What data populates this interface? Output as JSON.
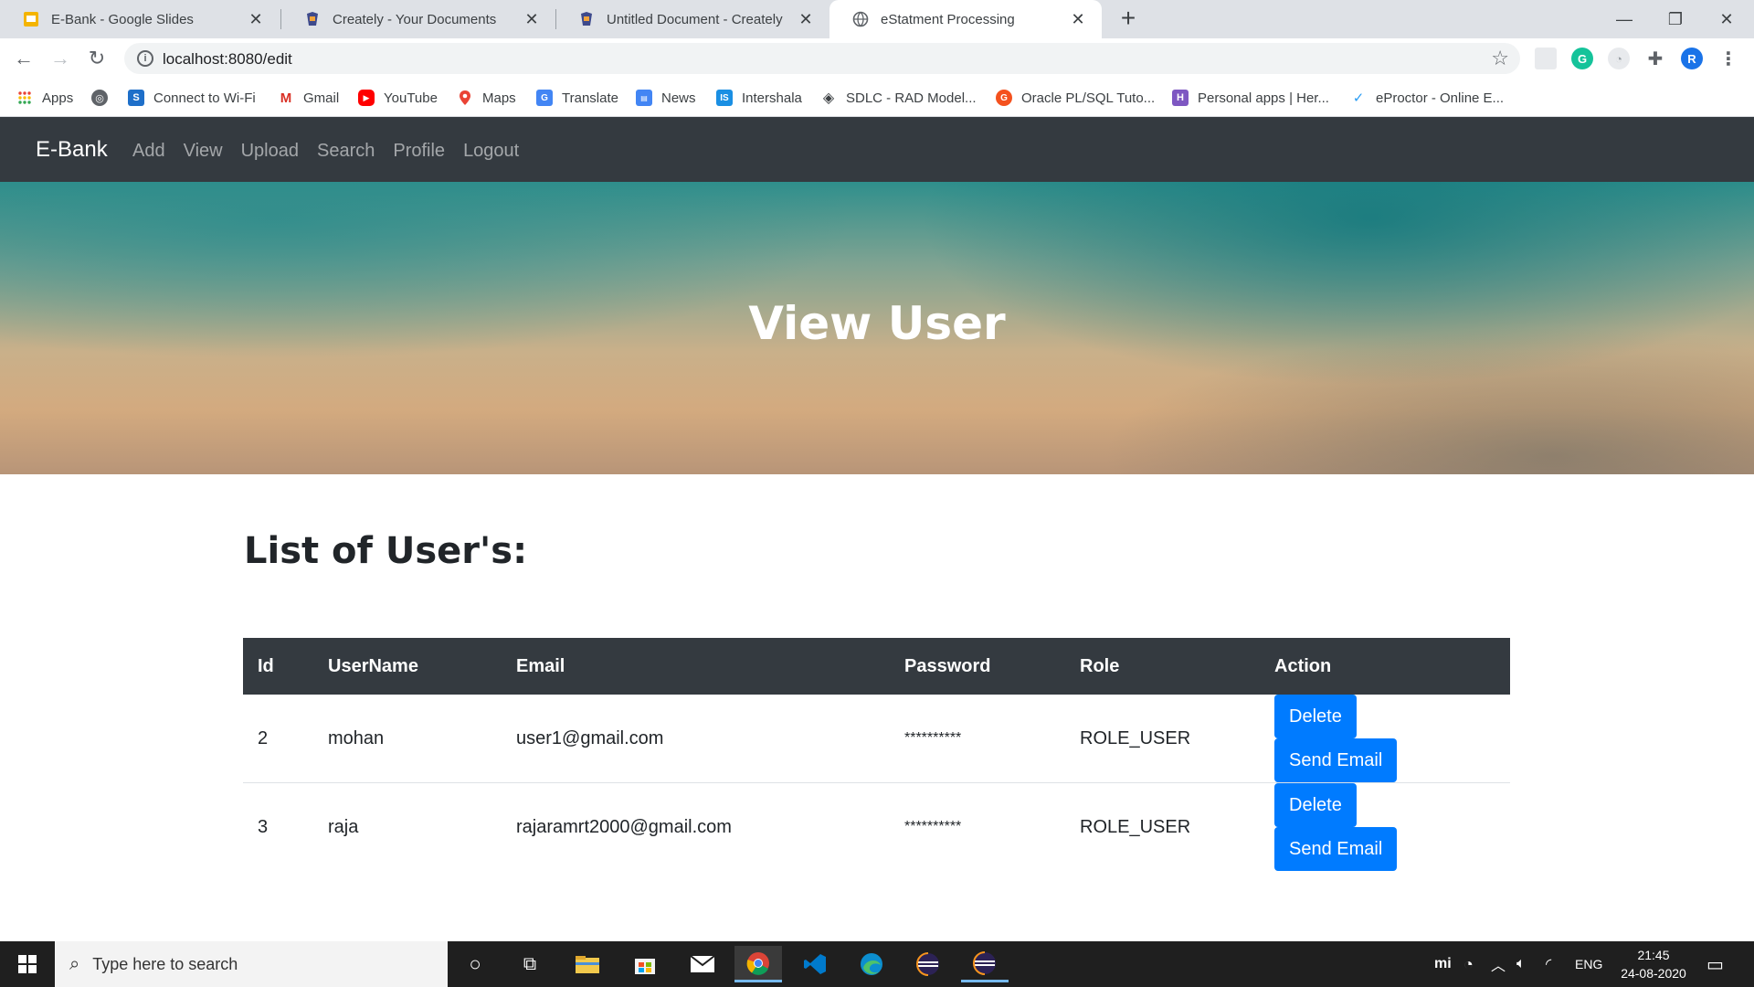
{
  "browser": {
    "tabs": [
      {
        "title": "E-Bank - Google Slides",
        "icon": "slides-icon"
      },
      {
        "title": "Creately - Your Documents",
        "icon": "creately-icon"
      },
      {
        "title": "Untitled Document - Creately",
        "icon": "creately-icon"
      },
      {
        "title": "eStatment Processing",
        "icon": "globe-icon"
      }
    ],
    "url": "localhost:8080/edit",
    "bookmarks": [
      {
        "label": "Apps"
      },
      {
        "label": ""
      },
      {
        "label": "Connect to Wi-Fi"
      },
      {
        "label": "Gmail"
      },
      {
        "label": "YouTube"
      },
      {
        "label": "Maps"
      },
      {
        "label": "Translate"
      },
      {
        "label": "News"
      },
      {
        "label": "Intershala"
      },
      {
        "label": "SDLC - RAD Model..."
      },
      {
        "label": "Oracle PL/SQL Tuto..."
      },
      {
        "label": "Personal apps | Her..."
      },
      {
        "label": "eProctor - Online E..."
      }
    ],
    "profile_initial": "R"
  },
  "nav": {
    "brand": "E-Bank",
    "links": [
      "Add",
      "View",
      "Upload",
      "Search",
      "Profile",
      "Logout"
    ]
  },
  "hero": {
    "title": "View User"
  },
  "content": {
    "list_title": "List of User's:",
    "table": {
      "headers": [
        "Id",
        "UserName",
        "Email",
        "Password",
        "Role",
        "Action"
      ],
      "rows": [
        {
          "id": "2",
          "username": "mohan",
          "email": "user1@gmail.com",
          "password": "**********",
          "role": "ROLE_USER",
          "delete_label": "Delete",
          "email_label": "Send Email"
        },
        {
          "id": "3",
          "username": "raja",
          "email": "rajaramrt2000@gmail.com",
          "password": "**********",
          "role": "ROLE_USER",
          "delete_label": "Delete",
          "email_label": "Send Email"
        }
      ]
    }
  },
  "taskbar": {
    "search_placeholder": "Type here to search",
    "language": "ENG",
    "time": "21:45",
    "date": "24-08-2020"
  },
  "colors": {
    "navbar": "#343a40",
    "primary_button": "#007bff"
  }
}
